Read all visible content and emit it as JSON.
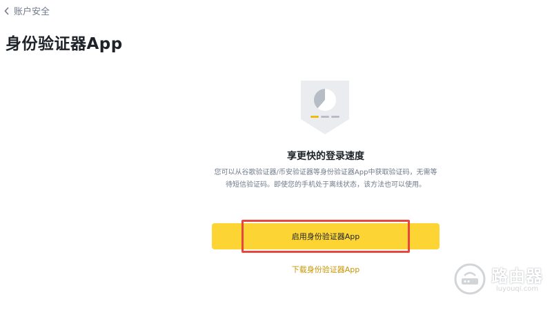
{
  "nav": {
    "back_label": "账户安全"
  },
  "page": {
    "title": "身份验证器App"
  },
  "content": {
    "headline": "享更快的登录速度",
    "description": "您可以从谷歌验证器/币安验证器等身份验证器App中获取验证码，无需等待短信验证码。即使您的手机处于离线状态，该方法也可以使用。",
    "enable_button_label": "启用身份验证器App",
    "download_link_label": "下载身份验证器App"
  },
  "watermark": {
    "cn": "路由器",
    "en": "luyouqi.com"
  },
  "colors": {
    "brand_yellow": "#fcd535",
    "link_gold": "#c99400",
    "highlight_red": "#e8453c",
    "text_primary": "#1e2329",
    "text_secondary": "#707a8a"
  },
  "icons": {
    "back": "chevron-left-icon",
    "hero": "authenticator-shield-icon"
  }
}
